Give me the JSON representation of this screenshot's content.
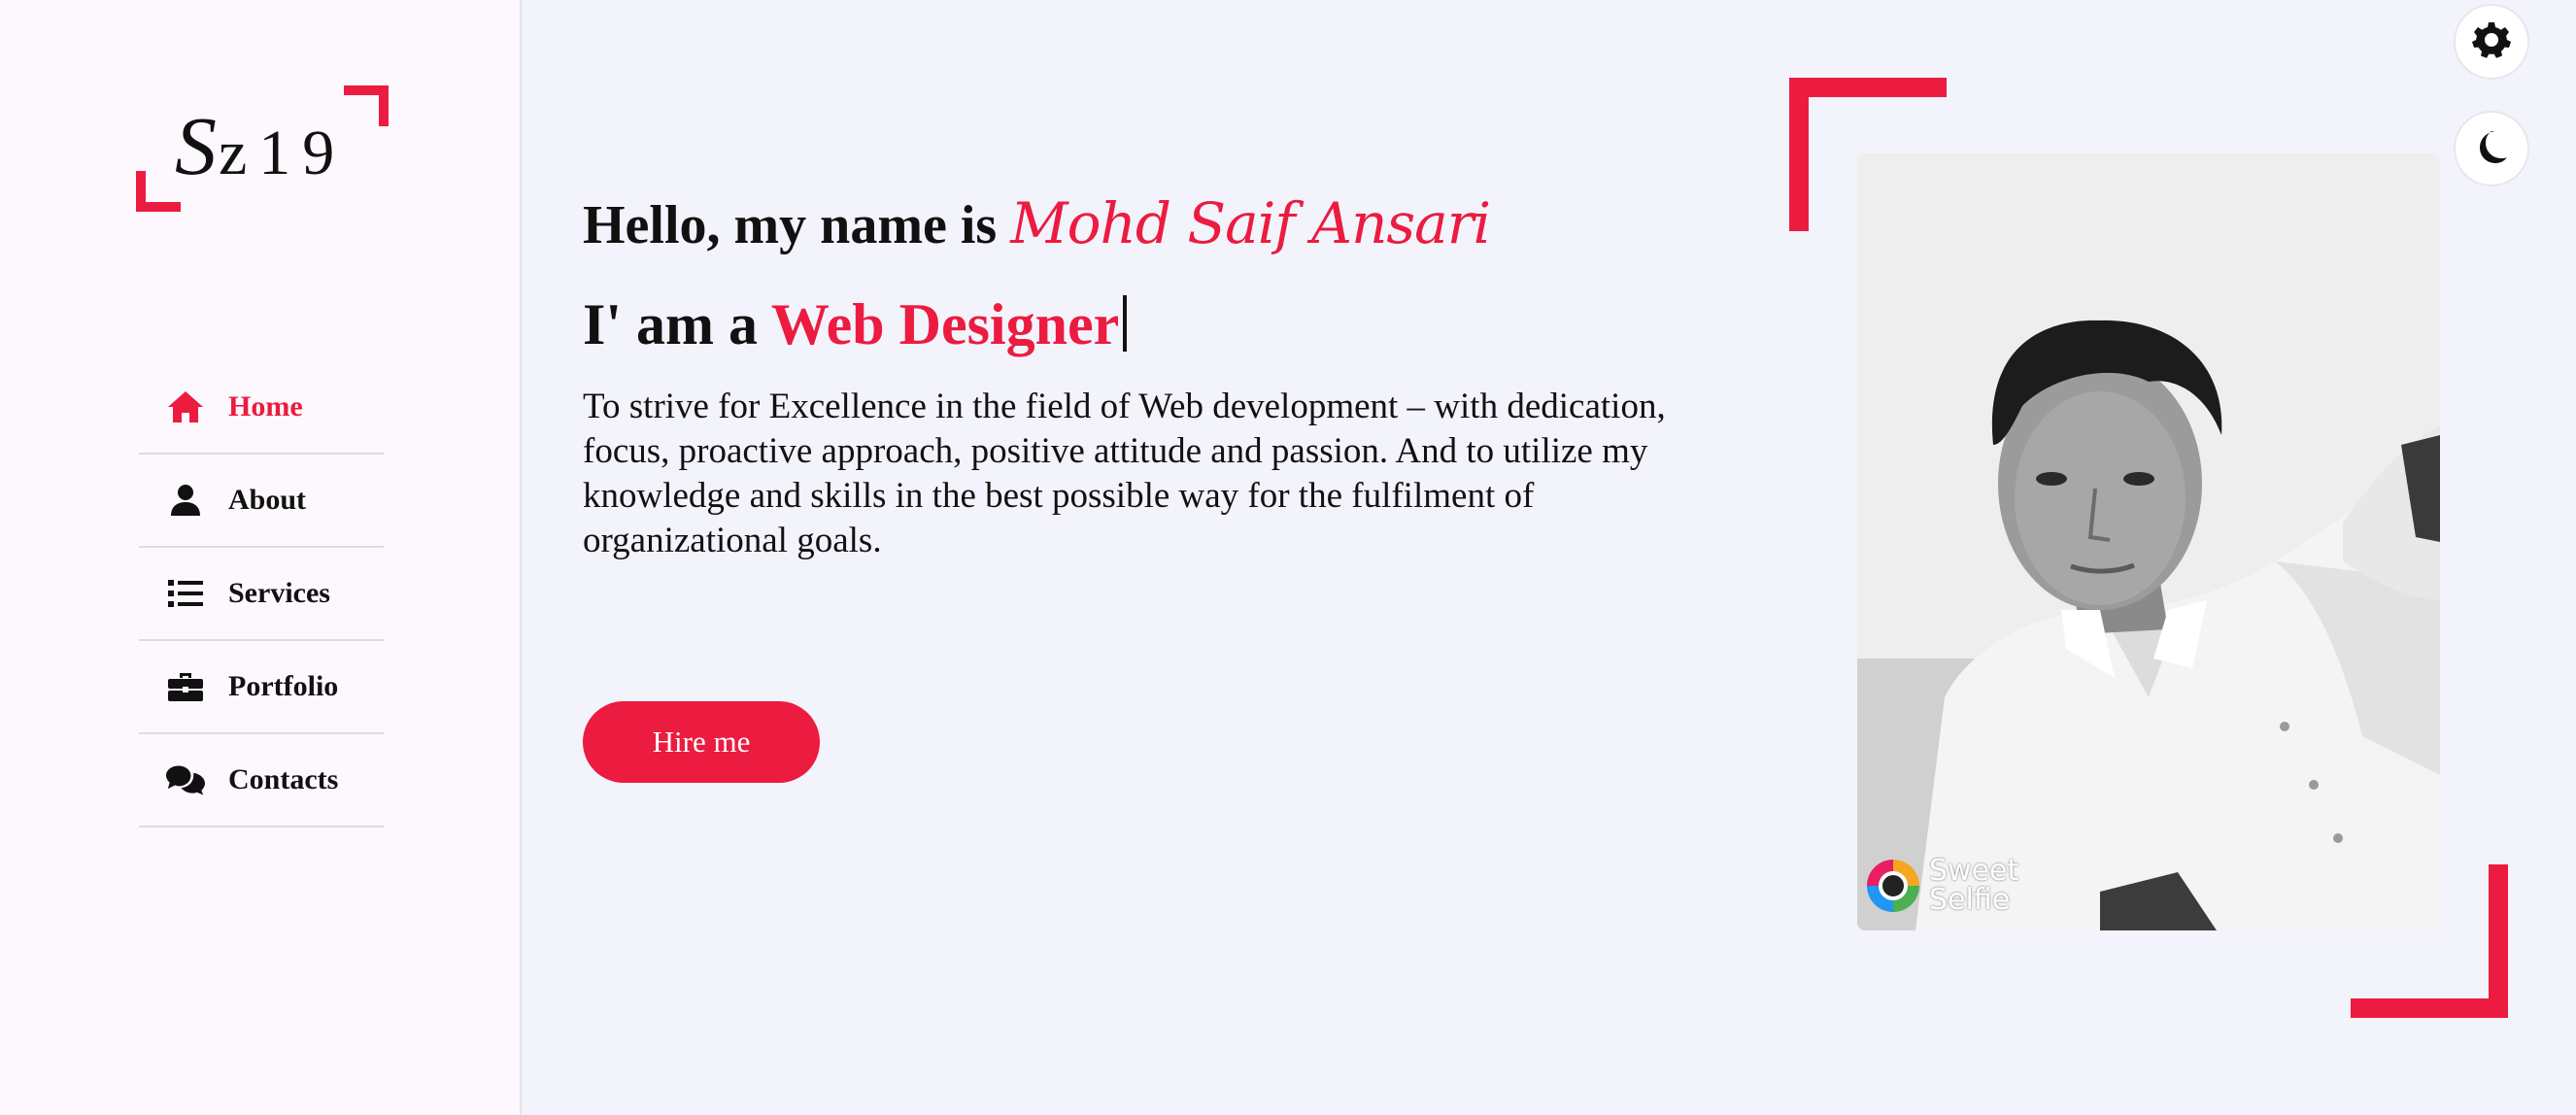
{
  "logo": {
    "text_s": "S",
    "text_rest": "z19"
  },
  "nav": {
    "items": [
      {
        "label": "Home",
        "icon": "home-icon",
        "active": true
      },
      {
        "label": "About",
        "icon": "user-icon",
        "active": false
      },
      {
        "label": "Services",
        "icon": "list-icon",
        "active": false
      },
      {
        "label": "Portfolio",
        "icon": "briefcase-icon",
        "active": false
      },
      {
        "label": "Contacts",
        "icon": "comments-icon",
        "active": false
      }
    ]
  },
  "hero": {
    "greeting_prefix": "Hello, my name is ",
    "name": "Mohd Saif Ansari",
    "role_prefix": "I' am a ",
    "role": "Web Designer",
    "description": "To strive for Excellence in the field of Web development – with dedication, focus, proactive approach, positive attitude and passion. And to utilize my knowledge and skills in the best possible way for the fulfilment of organizational goals.",
    "hire_label": "Hire me"
  },
  "photo": {
    "watermark_line1": "Sweet",
    "watermark_line2": "Selfie"
  },
  "controls": {
    "settings_icon": "gear-icon",
    "theme_icon": "moon-icon"
  },
  "colors": {
    "accent": "#ec1b40",
    "sidebar_bg": "#fdf8fd",
    "page_bg": "#f2f3fb",
    "text": "#111111"
  }
}
